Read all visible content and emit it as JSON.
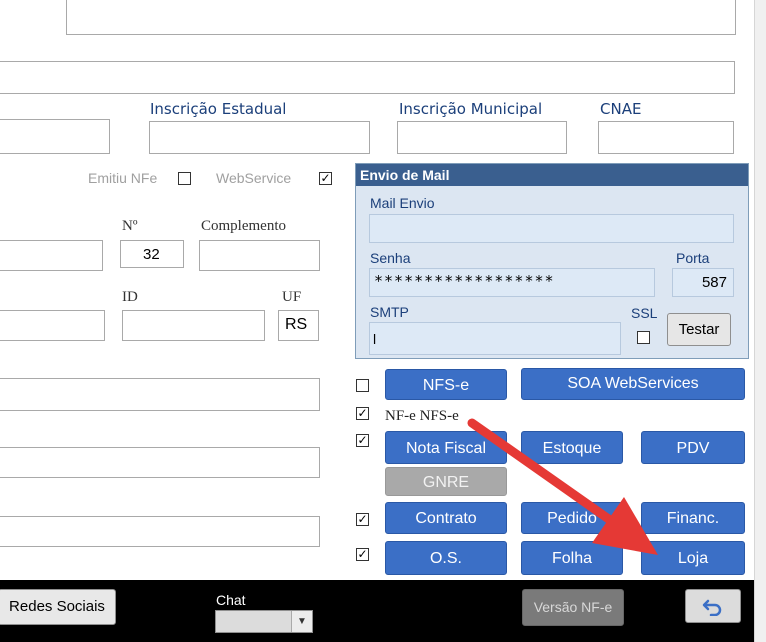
{
  "form": {
    "inscricao_estadual_label": "Inscrição Estadual",
    "inscricao_estadual_value": "",
    "inscricao_municipal_label": "Inscrição Municipal",
    "cnae_label": "CNAE",
    "emitiu_nfe_label": "Emitiu NFe",
    "webservice_label": "WebService",
    "numero_label": "Nº",
    "numero_value": "32",
    "complemento_label": "Complemento",
    "id_label": "ID",
    "id_value": "",
    "uf_label": "UF",
    "uf_value": "RS"
  },
  "mail": {
    "title": "Envio de Mail",
    "mail_envio_label": "Mail Envio",
    "senha_label": "Senha",
    "senha_value": "******************",
    "porta_label": "Porta",
    "porta_value": "587",
    "smtp_label": "SMTP",
    "smtp_value": "l",
    "ssl_label": "SSL",
    "testar_label": "Testar"
  },
  "modules": {
    "nfse": "NFS-e",
    "soa": "SOA WebServices",
    "nfe_nfse_label": "NF-e NFS-e",
    "nota_fiscal": "Nota Fiscal",
    "estoque": "Estoque",
    "pdv": "PDV",
    "gnre": "GNRE",
    "contrato": "Contrato",
    "pedido": "Pedido",
    "financ": "Financ.",
    "os": "O.S.",
    "folha": "Folha",
    "loja": "Loja"
  },
  "bottom": {
    "redes_sociais": "Redes Sociais",
    "chat_label": "Chat",
    "versao_nfe": "Versão NF-e"
  },
  "colors": {
    "button_blue": "#3b6fc6",
    "arrow_red": "#e53935",
    "label_blue": "#1b3f7a"
  }
}
